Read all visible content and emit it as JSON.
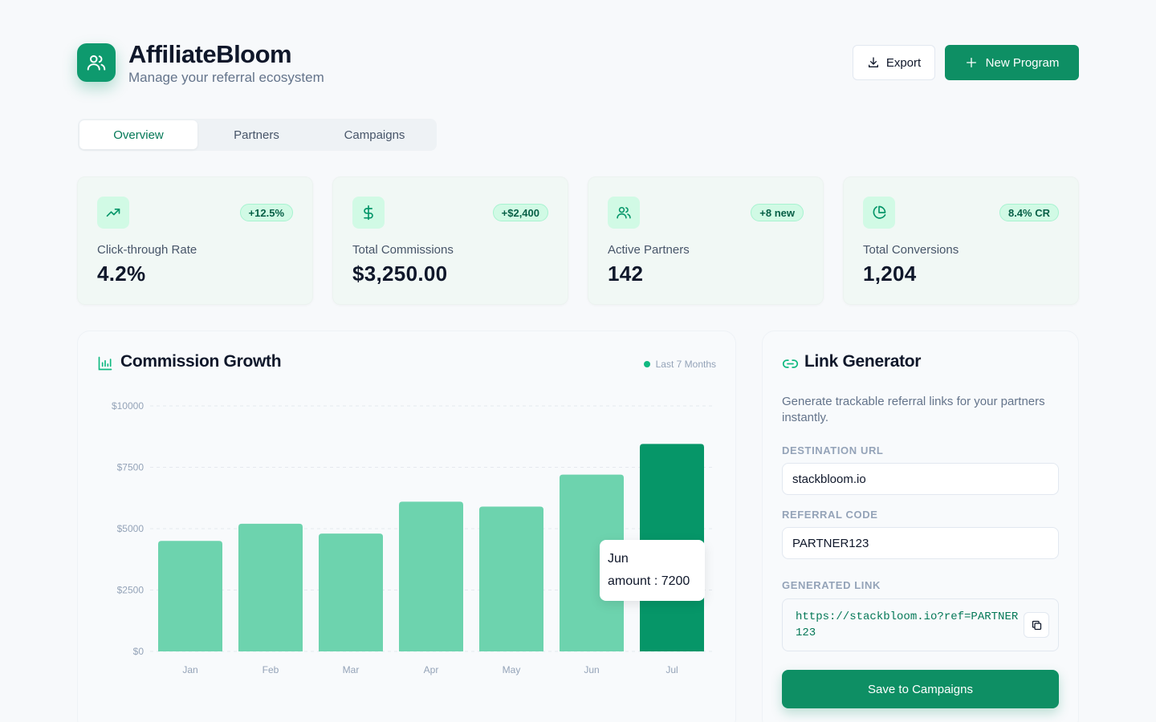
{
  "app": {
    "name": "AffiliateBloom",
    "subtitle": "Manage your referral ecosystem",
    "export_label": "Export",
    "new_program_label": "New Program"
  },
  "tabs": [
    {
      "label": "Overview",
      "active": true
    },
    {
      "label": "Partners",
      "active": false
    },
    {
      "label": "Campaigns",
      "active": false
    }
  ],
  "stats": [
    {
      "icon": "trending-up-icon",
      "badge": "+12.5%",
      "label": "Click-through Rate",
      "value": "4.2%"
    },
    {
      "icon": "dollar-icon",
      "badge": "+$2,400",
      "label": "Total Commissions",
      "value": "$3,250.00"
    },
    {
      "icon": "users-icon",
      "badge": "+8 new",
      "label": "Active Partners",
      "value": "142"
    },
    {
      "icon": "pie-chart-icon",
      "badge": "8.4% CR",
      "label": "Total Conversions",
      "value": "1,204"
    }
  ],
  "chart_panel": {
    "title": "Commission Growth",
    "legend": "Last 7 Months"
  },
  "chart_data": {
    "type": "bar",
    "categories": [
      "Jan",
      "Feb",
      "Mar",
      "Apr",
      "May",
      "Jun",
      "Jul"
    ],
    "series": [
      {
        "name": "amount",
        "values": [
          4500,
          5200,
          4800,
          6100,
          5900,
          7200,
          8450
        ]
      }
    ],
    "ylim": [
      0,
      10000
    ],
    "yticks": [
      "$0",
      "$2500",
      "$5000",
      "$7500",
      "$10000"
    ],
    "ytick_values": [
      0,
      2500,
      5000,
      7500,
      10000
    ],
    "highlight_index": 6,
    "tooltip": {
      "category": "Jun",
      "series": "amount",
      "value": 7200
    },
    "grid": true,
    "colors": {
      "bar": "#6dd3ae",
      "highlight": "#069668"
    }
  },
  "tooltip": {
    "title": "Jun",
    "line": "amount : 7200"
  },
  "link_generator": {
    "title": "Link Generator",
    "description": "Generate trackable referral links for your partners instantly.",
    "destination_label": "DESTINATION URL",
    "destination_value": "stackbloom.io",
    "code_label": "REFERRAL CODE",
    "code_value": "PARTNER123",
    "generated_label": "GENERATED LINK",
    "generated_value": "https://stackbloom.io?ref=PARTNER123",
    "save_label": "Save to Campaigns"
  },
  "colors": {
    "accent": "#0e8f64",
    "accent_light": "#d1fae5",
    "background": "#f7f9fb"
  }
}
